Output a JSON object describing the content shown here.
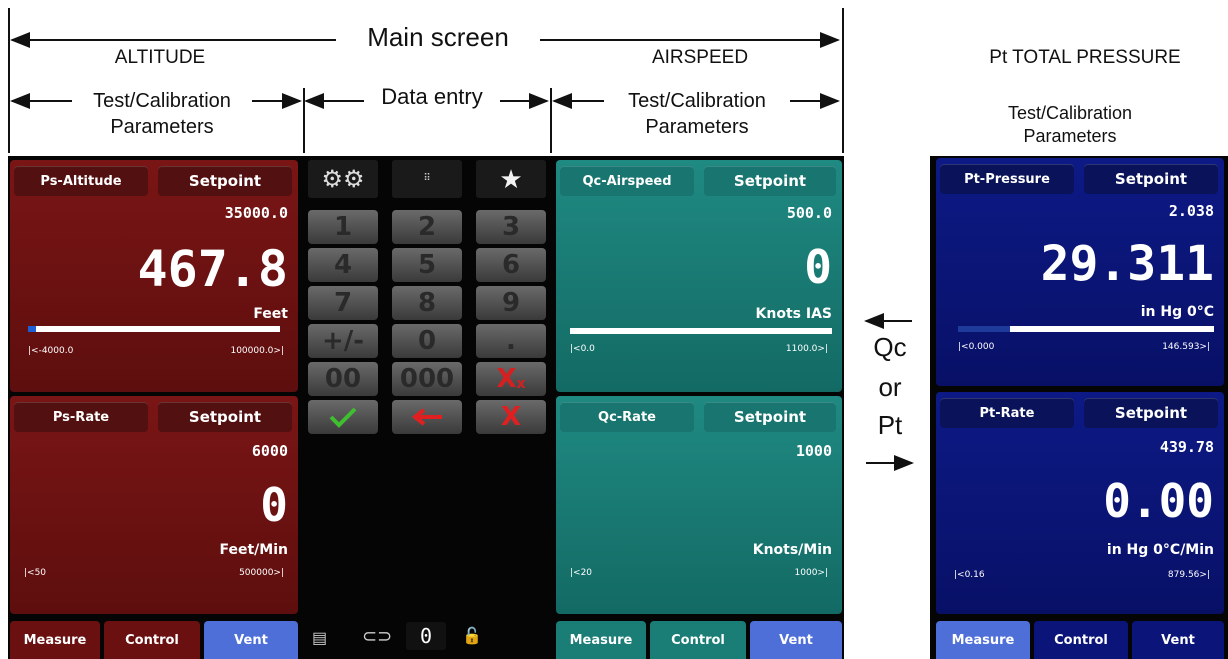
{
  "annotations": {
    "main_screen": "Main screen",
    "altitude": "ALTITUDE",
    "airspeed": "AIRSPEED",
    "pt_total": "Pt TOTAL PRESSURE",
    "test_cal_line1": "Test/Calibration",
    "test_cal_line2": "Parameters",
    "data_entry": "Data entry",
    "qc": "Qc",
    "or": "or",
    "pt": "Pt"
  },
  "altitude_panel": {
    "label": "Ps-Altitude",
    "setpoint_label": "Setpoint",
    "setpoint": "35000.0",
    "value": "467.8",
    "unit": "Feet",
    "range_min": "|<-4000.0",
    "range_max": "100000.0>|"
  },
  "altitude_rate_panel": {
    "label": "Ps-Rate",
    "setpoint_label": "Setpoint",
    "setpoint": "6000",
    "value": "0",
    "unit": "Feet/Min",
    "range_min": "|<50",
    "range_max": "500000>|"
  },
  "airspeed_panel": {
    "label": "Qc-Airspeed",
    "setpoint_label": "Setpoint",
    "setpoint": "500.0",
    "value": "0",
    "unit": "Knots IAS",
    "range_min": "|<0.0",
    "range_max": "1100.0>|"
  },
  "airspeed_rate_panel": {
    "label": "Qc-Rate",
    "setpoint_label": "Setpoint",
    "setpoint": "1000",
    "value": "",
    "unit": "Knots/Min",
    "range_min": "|<20",
    "range_max": "1000>|"
  },
  "pt_panel": {
    "label": "Pt-Pressure",
    "setpoint_label": "Setpoint",
    "setpoint": "2.038",
    "value": "29.311",
    "unit": "in Hg 0°C",
    "range_min": "|<0.000",
    "range_max": "146.593>|"
  },
  "pt_rate_panel": {
    "label": "Pt-Rate",
    "setpoint_label": "Setpoint",
    "setpoint": "439.78",
    "value": "0.00",
    "unit": "in Hg 0°C/Min",
    "range_min": "|<0.16",
    "range_max": "879.56>|"
  },
  "keypad": {
    "keys": [
      "1",
      "2",
      "3",
      "4",
      "5",
      "6",
      "7",
      "8",
      "9",
      "+/-",
      "0",
      ".",
      "00",
      "000"
    ],
    "clear_label": "X",
    "clear_sub": "x",
    "cancel_label": "X",
    "bottom_zero": "0"
  },
  "tabs": {
    "measure": "Measure",
    "control": "Control",
    "vent": "Vent"
  },
  "colors": {
    "red_panel": "#6b1212",
    "teal_panel": "#1a7d76",
    "blue_panel": "#0b1478",
    "active_tab": "#4f6fd8"
  }
}
